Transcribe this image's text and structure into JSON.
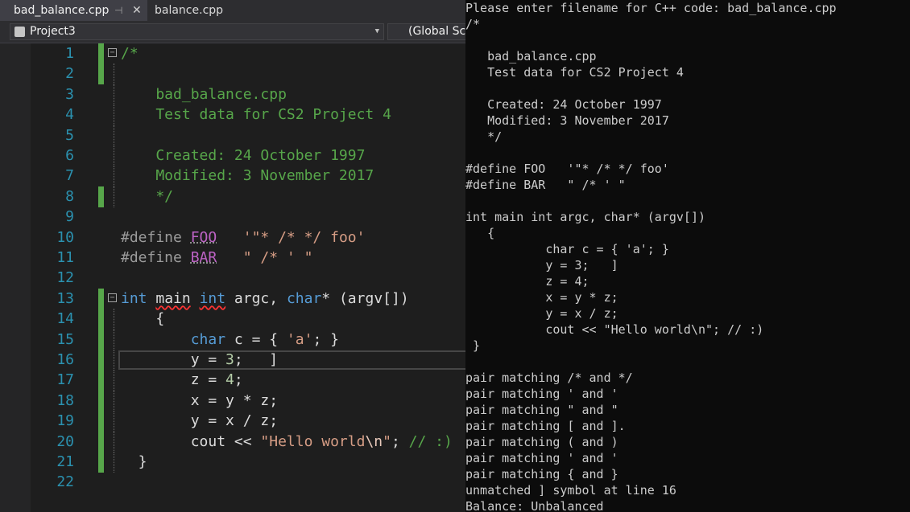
{
  "ide": {
    "tabs": [
      {
        "label": "bad_balance.cpp",
        "pin_glyph": "⊣",
        "close_glyph": "✕"
      },
      {
        "label": "balance.cpp"
      }
    ],
    "nav": {
      "project": "Project3",
      "scope": "(Global Scope)"
    },
    "icons": {
      "project": "project-icon",
      "fold": "fold-toggle-icon",
      "dropdown": "chevron-down-icon"
    },
    "colors": {
      "comment": "#57a64a",
      "keyword": "#569cd6",
      "string": "#d69d85",
      "line_number": "#2b91af",
      "change_bar": "#57a64a"
    },
    "editor": {
      "line_numbers": [
        "1",
        "2",
        "3",
        "4",
        "5",
        "6",
        "7",
        "8",
        "9",
        "10",
        "11",
        "12",
        "13",
        "14",
        "15",
        "16",
        "17",
        "18",
        "19",
        "20",
        "21",
        "22"
      ],
      "code": {
        "l1": "/*",
        "l3": "    bad_balance.cpp",
        "l4": "    Test data for CS2 Project 4",
        "l6": "    Created: 24 October 1997",
        "l7": "    Modified: 3 November 2017",
        "l8": "    */",
        "l10": {
          "pp": "#define ",
          "name": "FOO",
          "pad": "   ",
          "val": "'\"* /* */ foo'"
        },
        "l11": {
          "pp": "#define ",
          "name": "BAR",
          "pad": "   ",
          "val": "\" /* ' \""
        },
        "l13": {
          "kw1": "int",
          "sp1": " ",
          "fn": "main",
          "sp2": " ",
          "kw2": "int",
          "mid": " argc, ",
          "kw3": "char",
          "rest": "* (argv[])"
        },
        "l14": "    {",
        "l15": {
          "ind": "        ",
          "kw": "char",
          "mid": " c = { ",
          "str": "'a'",
          "end": "; }"
        },
        "l16": {
          "pre": "        y = ",
          "num": "3",
          "post": ";   ]"
        },
        "l17": {
          "pre": "        z = ",
          "num": "4",
          "post": ";"
        },
        "l18": "        x = y * z;",
        "l19": "        y = x / z;",
        "l20": {
          "pre": "        cout << ",
          "str": "\"Hello world",
          "esc": "\\n",
          "strend": "\"",
          "semi": "; ",
          "com": "// :)"
        },
        "l21": "  }"
      }
    }
  },
  "console": {
    "lines": [
      "Please enter filename for C++ code: bad_balance.cpp",
      "/*",
      "",
      "   bad_balance.cpp",
      "   Test data for CS2 Project 4",
      "",
      "   Created: 24 October 1997",
      "   Modified: 3 November 2017",
      "   */",
      "",
      "#define FOO   '\"* /* */ foo'",
      "#define BAR   \" /* ' \"",
      "",
      "int main int argc, char* (argv[])",
      "   {",
      "           char c = { 'a'; }",
      "           y = 3;   ]",
      "           z = 4;",
      "           x = y * z;",
      "           y = x / z;",
      "           cout << \"Hello world\\n\"; // :)",
      " }",
      "",
      "pair matching /* and */",
      "pair matching ' and '",
      "pair matching \" and \"",
      "pair matching [ and ].",
      "pair matching ( and )",
      "pair matching ' and '",
      "pair matching { and }",
      "unmatched ] symbol at line 16",
      "Balance: Unbalanced"
    ]
  }
}
